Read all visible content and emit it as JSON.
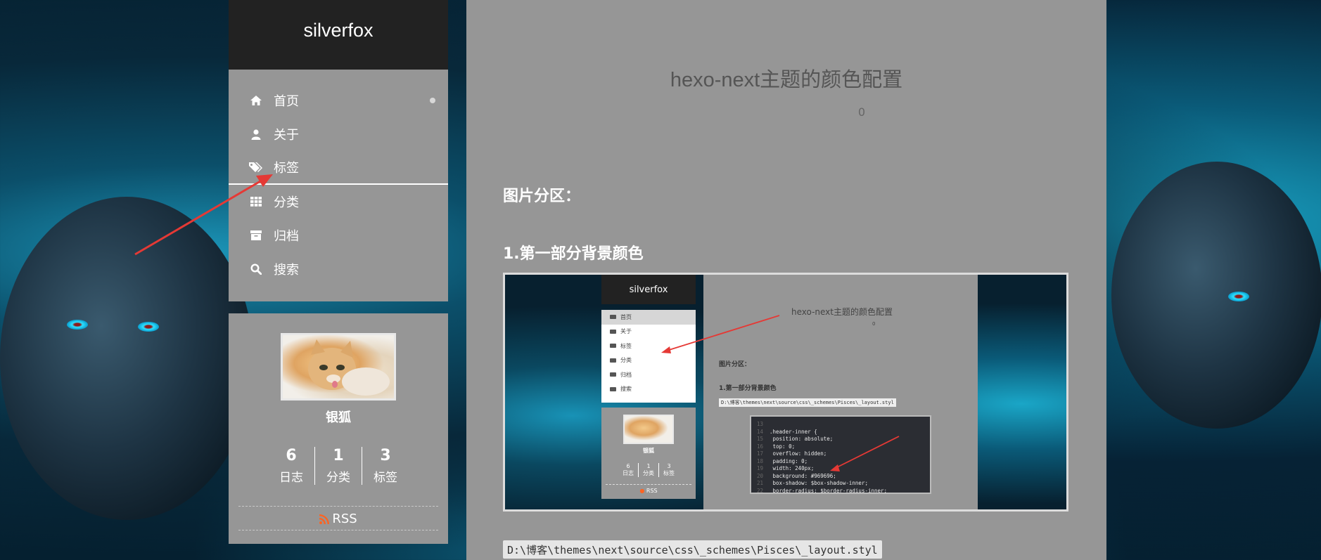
{
  "site": {
    "title": "silverfox"
  },
  "sidebar": {
    "menu": [
      {
        "label": "首页",
        "icon": "home-icon"
      },
      {
        "label": "关于",
        "icon": "user-icon"
      },
      {
        "label": "标签",
        "icon": "tags-icon"
      },
      {
        "label": "分类",
        "icon": "th-icon"
      },
      {
        "label": "归档",
        "icon": "archive-icon"
      },
      {
        "label": "搜索",
        "icon": "search-icon"
      }
    ],
    "profile": {
      "name": "银狐",
      "stats": [
        {
          "num": "6",
          "label": "日志"
        },
        {
          "num": "1",
          "label": "分类"
        },
        {
          "num": "3",
          "label": "标签"
        }
      ],
      "rss": "RSS"
    }
  },
  "post": {
    "title": "hexo-next主题的颜色配置",
    "meta_count": "0",
    "section1": "图片分区：",
    "section2": "1.第一部分背景颜色",
    "path": "D:\\博客\\themes\\next\\source\\css\\_schemes\\Pisces\\_layout.styl"
  },
  "embedded_screenshot": {
    "brand": "silverfox",
    "menu": [
      "首页",
      "关于",
      "标签",
      "分类",
      "归档",
      "搜索"
    ],
    "title": "hexo-next主题的颜色配置",
    "meta_count": "0",
    "section1": "图片分区：",
    "section2": "1.第一部分背景颜色",
    "path": "D:\\博客\\themes\\next\\source\\css\\_schemes\\Pisces\\_layout.styl",
    "profile_name": "银狐",
    "stats": [
      {
        "num": "6",
        "label": "日志"
      },
      {
        "num": "1",
        "label": "分类"
      },
      {
        "num": "3",
        "label": "标签"
      }
    ],
    "rss": "RSS",
    "code_lines": [
      {
        "n": "13",
        "t": ""
      },
      {
        "n": "14",
        "t": ".header-inner {"
      },
      {
        "n": "15",
        "t": "  position: absolute;"
      },
      {
        "n": "16",
        "t": "  top: 0;"
      },
      {
        "n": "17",
        "t": "  overflow: hidden;"
      },
      {
        "n": "18",
        "t": "  padding: 0;"
      },
      {
        "n": "19",
        "t": "  width: 240px;"
      },
      {
        "n": "20",
        "t": "  background: #969696;"
      },
      {
        "n": "21",
        "t": "  box-shadow: $box-shadow-inner;"
      },
      {
        "n": "22",
        "t": "  border-radius: $border-radius-inner;"
      }
    ]
  },
  "colors": {
    "sidebar_bg": "#969696",
    "brand_bg": "#222222",
    "arrow": "#e53935",
    "rss": "#fc6423"
  }
}
